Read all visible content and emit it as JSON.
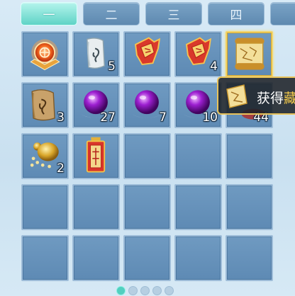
{
  "tabs": [
    {
      "label": "一",
      "active": true
    },
    {
      "label": "二",
      "active": false
    },
    {
      "label": "三",
      "active": false
    },
    {
      "label": "四",
      "active": false
    },
    {
      "label": "",
      "active": false
    }
  ],
  "inventory": {
    "rows": [
      [
        {
          "icon": "orange-emblem-icon",
          "count": ""
        },
        {
          "icon": "silver-scroll-icon",
          "count": "5"
        },
        {
          "icon": "red-gold-talisman-icon",
          "count": ""
        },
        {
          "icon": "red-gold-talisman-icon",
          "count": "4"
        },
        {
          "icon": "golden-map-scroll-icon",
          "count": ""
        }
      ],
      [
        {
          "icon": "bronze-scroll-icon",
          "count": "3"
        },
        {
          "icon": "purple-orb-icon",
          "count": "27"
        },
        {
          "icon": "purple-orb-icon",
          "count": "7"
        },
        {
          "icon": "purple-orb-icon",
          "count": "10"
        },
        {
          "icon": "hidden-item",
          "count": "44"
        }
      ],
      [
        {
          "icon": "gold-gourd-icon",
          "count": "2"
        },
        {
          "icon": "red-charm-tag-icon",
          "count": ""
        },
        {
          "icon": "",
          "count": ""
        },
        {
          "icon": "",
          "count": ""
        },
        {
          "icon": "",
          "count": ""
        }
      ],
      [
        {
          "icon": "",
          "count": ""
        },
        {
          "icon": "",
          "count": ""
        },
        {
          "icon": "",
          "count": ""
        },
        {
          "icon": "",
          "count": ""
        },
        {
          "icon": "",
          "count": ""
        }
      ],
      [
        {
          "icon": "",
          "count": ""
        },
        {
          "icon": "",
          "count": ""
        },
        {
          "icon": "",
          "count": ""
        },
        {
          "icon": "",
          "count": ""
        },
        {
          "icon": "",
          "count": ""
        }
      ]
    ]
  },
  "tooltip": {
    "text": "获得",
    "highlight": "藏",
    "icon": "golden-map-scroll-icon"
  },
  "pager": {
    "pages": 5,
    "active": 1
  },
  "colors": {
    "accent": "#5fd3c6",
    "slot": "#6f9ac1",
    "tooltip_border": "#e8c35b"
  }
}
